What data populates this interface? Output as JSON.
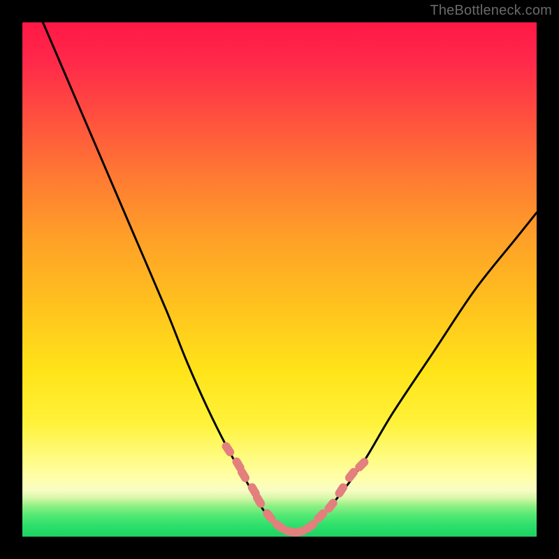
{
  "watermark": "TheBottleneck.com",
  "chart_data": {
    "type": "line",
    "title": "",
    "xlabel": "",
    "ylabel": "",
    "xlim": [
      0,
      100
    ],
    "ylim": [
      0,
      100
    ],
    "grid": false,
    "legend": false,
    "series": [
      {
        "name": "bottleneck-curve",
        "color": "#000000",
        "x": [
          4,
          10,
          16,
          22,
          28,
          32,
          36,
          40,
          44,
          47,
          50,
          53,
          56,
          60,
          66,
          72,
          80,
          88,
          96,
          100
        ],
        "y": [
          100,
          86,
          72,
          58,
          44,
          34,
          25,
          17,
          10,
          5,
          2,
          1,
          2,
          6,
          14,
          24,
          36,
          48,
          58,
          63
        ]
      },
      {
        "name": "flat-segment-highlight",
        "type": "scatter",
        "color": "#e37f7d",
        "x": [
          40,
          42,
          43,
          45,
          46,
          48,
          50,
          52,
          54,
          56,
          58,
          60,
          62,
          64,
          66
        ],
        "y": [
          17,
          14,
          12,
          9,
          7,
          4,
          2,
          1,
          1,
          2,
          4,
          6,
          9,
          12,
          14
        ]
      }
    ],
    "annotations": []
  },
  "colors": {
    "gradient_top": "#ff1846",
    "gradient_mid": "#ffe419",
    "gradient_bottom": "#1fd063",
    "curve": "#000000",
    "highlight": "#e37f7d",
    "frame": "#000000",
    "watermark": "#6a6a6a"
  }
}
